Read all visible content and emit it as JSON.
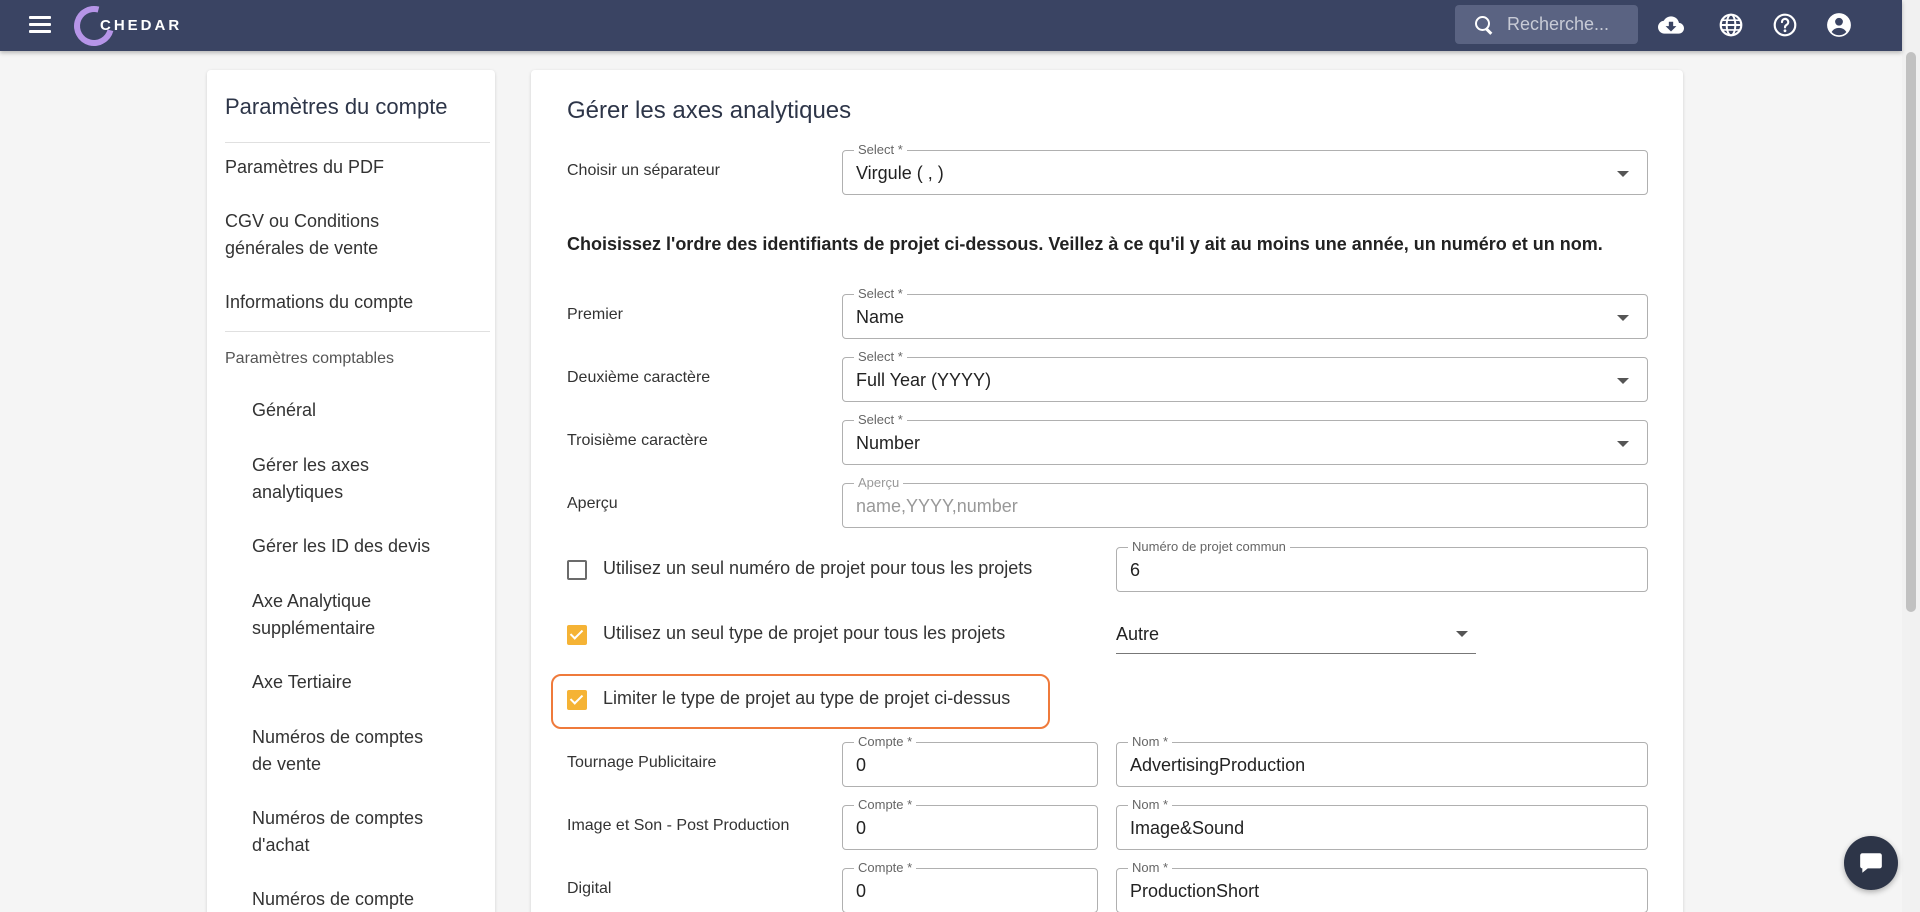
{
  "header": {
    "logo_text": "CHEDAR",
    "search_placeholder": "Recherche..."
  },
  "sidebar": {
    "title": "Paramètres du compte",
    "items": [
      "Paramètres du PDF",
      "CGV ou Conditions\ngénérales de vente",
      "Informations du compte"
    ],
    "section_label": "Paramètres comptables",
    "sub_items": [
      "Général",
      "Gérer les axes\nanalytiques",
      "Gérer les ID des devis",
      "Axe Analytique\nsupplémentaire",
      "Axe Tertiaire",
      "Numéros de comptes\nde vente",
      "Numéros de comptes\nd'achat",
      "Numéros de compte"
    ]
  },
  "main": {
    "title": "Gérer les axes analytiques",
    "separator": {
      "label": "Choisir un séparateur",
      "field_label": "Select *",
      "value": "Virgule ( , )"
    },
    "instructions": "Choisissez l'ordre des identifiants de projet ci-dessous. Veillez à ce qu'il y ait au moins une année, un numéro et un nom.",
    "selects": [
      {
        "label": "Premier",
        "field_label": "Select *",
        "value": "Name"
      },
      {
        "label": "Deuxième caractère",
        "field_label": "Select *",
        "value": "Full Year (YYYY)"
      },
      {
        "label": "Troisième caractère",
        "field_label": "Select *",
        "value": "Number"
      }
    ],
    "preview": {
      "label": "Aperçu",
      "field_label": "Aperçu",
      "placeholder": "name,YYYY,number"
    },
    "single_number": {
      "label": "Utilisez un seul numéro de projet pour tous les projets",
      "checked": false,
      "field_label": "Numéro de projet commun",
      "value": "6"
    },
    "single_type": {
      "label": "Utilisez un seul type de projet pour tous les projets",
      "checked": true,
      "value": "Autre"
    },
    "limit_type": {
      "label": "Limiter le type de projet au type de projet ci-dessus",
      "checked": true
    },
    "project_types": [
      {
        "label": "Tournage Publicitaire",
        "compte_label": "Compte *",
        "compte": "0",
        "nom_label": "Nom *",
        "nom": "AdvertisingProduction"
      },
      {
        "label": "Image et Son - Post Production",
        "compte_label": "Compte *",
        "compte": "0",
        "nom_label": "Nom *",
        "nom": "Image&Sound"
      },
      {
        "label": "Digital",
        "compte_label": "Compte *",
        "compte": "0",
        "nom_label": "Nom *",
        "nom": "ProductionShort"
      }
    ]
  },
  "colors": {
    "topbar": "#3a4463",
    "accent_checkbox": "#f5b335",
    "highlight": "#ef7a3b"
  }
}
